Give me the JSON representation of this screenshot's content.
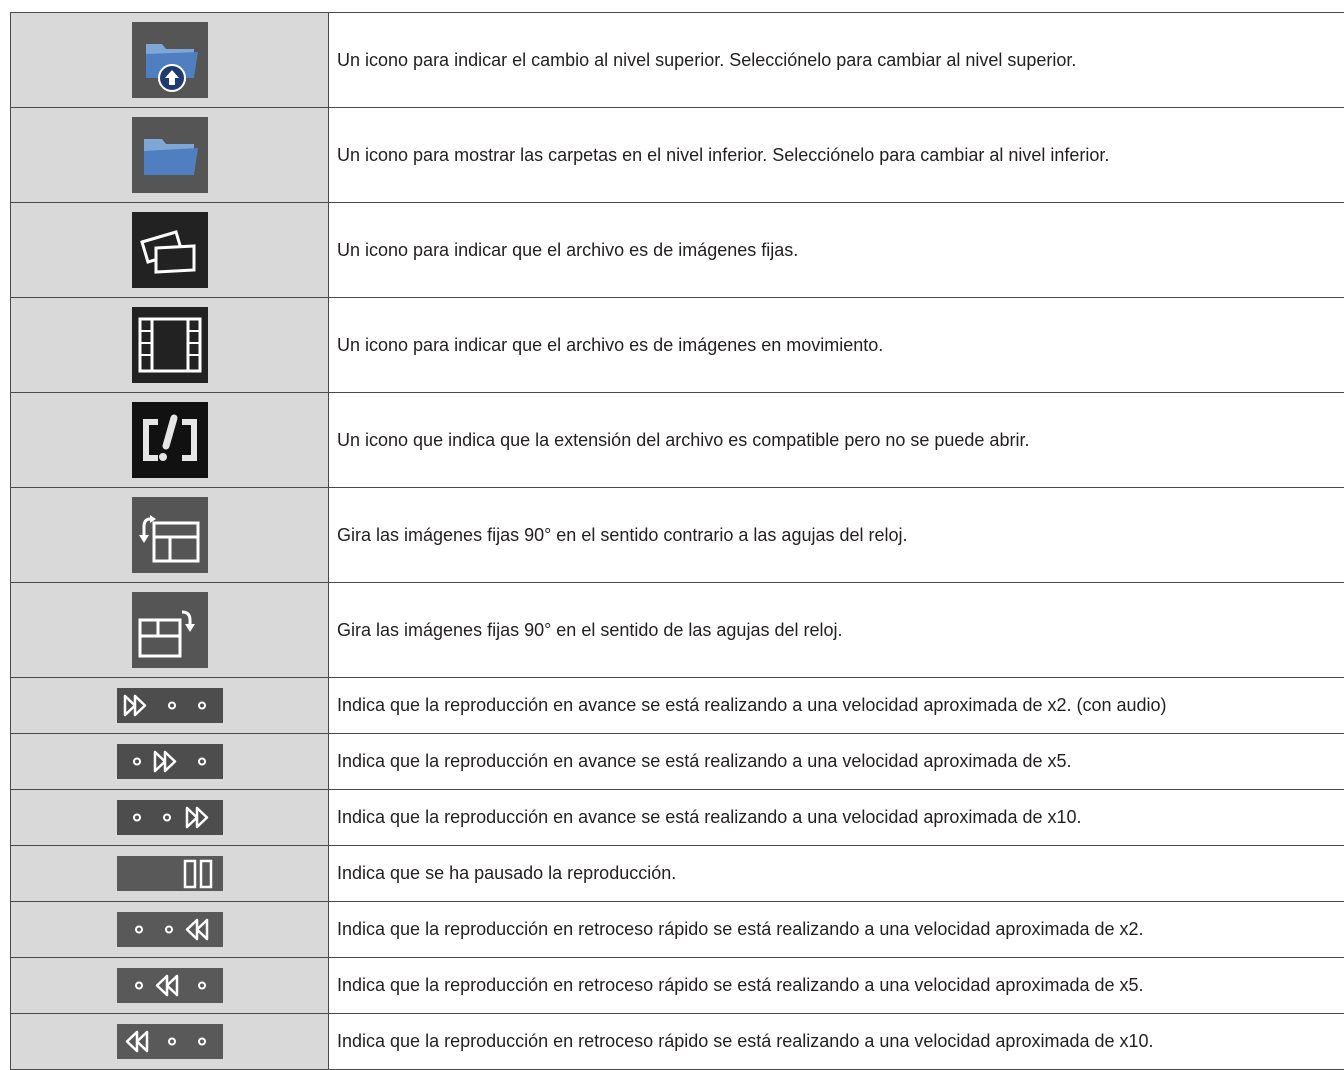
{
  "rows": [
    {
      "icon": "folder-up-icon",
      "description": "Un icono para indicar el cambio al nivel superior. Selecciónelo para cambiar al nivel superior."
    },
    {
      "icon": "folder-icon",
      "description": "Un icono para mostrar las carpetas en el nivel inferior. Selecciónelo para cambiar al nivel inferior."
    },
    {
      "icon": "still-images-icon",
      "description": "Un icono para indicar que el archivo es de imágenes fijas."
    },
    {
      "icon": "film-icon",
      "description": "Un icono para indicar que el archivo es de imágenes en movimiento."
    },
    {
      "icon": "unsupported-file-icon",
      "description": "Un icono que indica que la extensión del archivo es compatible pero no se puede abrir."
    },
    {
      "icon": "rotate-counterclockwise-icon",
      "description": "Gira las imágenes fijas 90° en el sentido contrario a las agujas del reloj."
    },
    {
      "icon": "rotate-clockwise-icon",
      "description": "Gira las imágenes fijas 90° en el sentido de las agujas del reloj."
    },
    {
      "icon": "fast-forward-x2-icon",
      "description": "Indica que la reproducción en avance se está realizando a una velocidad aproximada de x2. (con audio)"
    },
    {
      "icon": "fast-forward-x5-icon",
      "description": "Indica que la reproducción en avance se está realizando a una velocidad aproximada de x5."
    },
    {
      "icon": "fast-forward-x10-icon",
      "description": "Indica que la reproducción en avance se está realizando a una velocidad aproximada de x10."
    },
    {
      "icon": "pause-icon",
      "description": "Indica que se ha pausado la reproducción."
    },
    {
      "icon": "rewind-x2-icon",
      "description": "Indica que la reproducción en retroceso rápido se está realizando a una velocidad aproximada de x2."
    },
    {
      "icon": "rewind-x5-icon",
      "description": "Indica que la reproducción en retroceso rápido se está realizando a una velocidad aproximada de x5."
    },
    {
      "icon": "rewind-x10-icon",
      "description": "Indica que la reproducción en retroceso rápido se está realizando a una velocidad aproximada de x10."
    }
  ]
}
